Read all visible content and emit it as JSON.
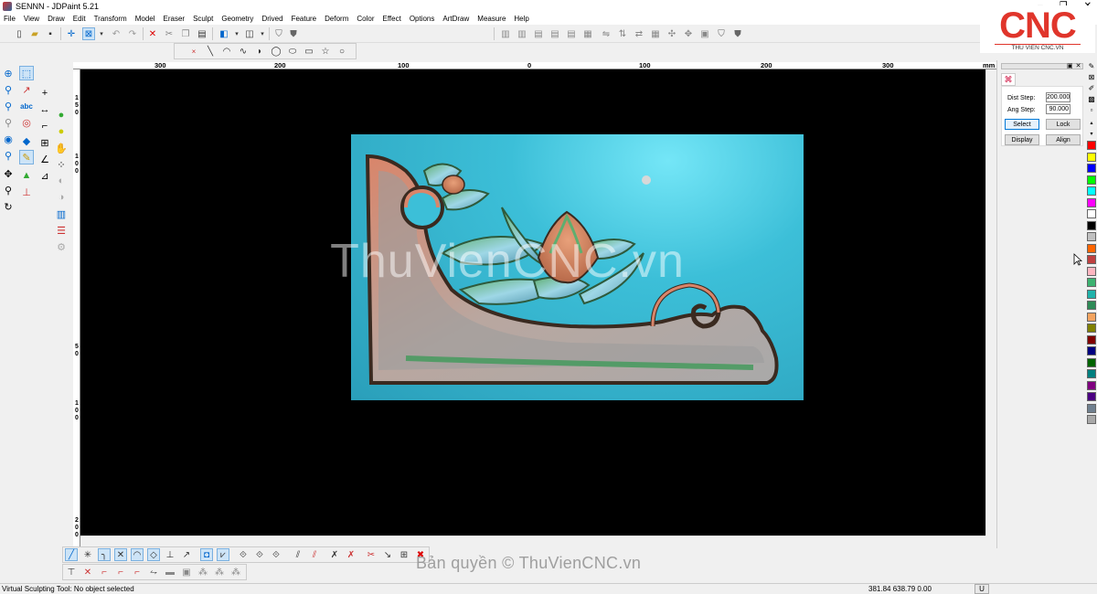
{
  "window": {
    "title": "SENNN - JDPaint 5.21"
  },
  "menu": [
    "File",
    "View",
    "Draw",
    "Edit",
    "Transform",
    "Model",
    "Eraser",
    "Sculpt",
    "Geometry",
    "Drived",
    "Feature",
    "Deform",
    "Color",
    "Effect",
    "Options",
    "ArtDraw",
    "Measure",
    "Help"
  ],
  "logo": {
    "brand": "CNC",
    "subtitle": "THU VIEN CNC.VN"
  },
  "ruler": {
    "unit": "mm",
    "h_ticks": [
      "300",
      "200",
      "100",
      "0",
      "100",
      "200",
      "300"
    ],
    "v_ticks": [
      "1",
      "5",
      "0",
      "1",
      "0",
      "0",
      "5",
      "0",
      "1",
      "0",
      "0",
      "2",
      "0",
      "0"
    ]
  },
  "viewport": {
    "watermark": "ThuVienCNC.vn",
    "background": "#000000",
    "relief_color": "#3cbfd8"
  },
  "panel": {
    "dist_step_label": "Dist Step:",
    "dist_step_value": "200.000",
    "ang_step_label": "Ang Step:",
    "ang_step_value": "90.000",
    "select_label": "Select",
    "lock_label": "Lock",
    "display_label": "Display",
    "align_label": "Align"
  },
  "palette": [
    "#ff0000",
    "#ffff00",
    "#0000ff",
    "#00ff00",
    "#00ffff",
    "#ff00ff",
    "#ffffff",
    "#000000",
    "#c0c0c0",
    "#ff6600",
    "#c04040",
    "#ffb6c1",
    "#3cb371",
    "#20b2aa",
    "#2e8b57",
    "#f4a460",
    "#808000",
    "#800000",
    "#000080",
    "#006400",
    "#008080",
    "#800080",
    "#4b0082",
    "#708090",
    "#a9a9a9"
  ],
  "footer": {
    "copyright": "Bản quyền © ThuVienCNC.vn"
  },
  "status": {
    "message": "Virtual Sculpting Tool: No object selected",
    "coords": "381.84 638.79 0.00",
    "unit_indicator": "U"
  }
}
